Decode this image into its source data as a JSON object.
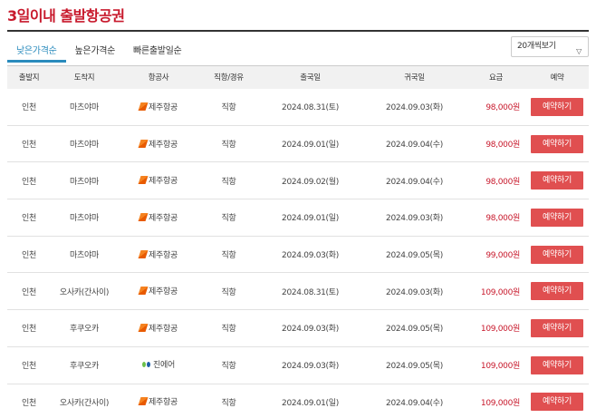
{
  "page": {
    "title": "3일이내 출발항공권"
  },
  "tabs": [
    {
      "label": "낮은가격순",
      "active": true
    },
    {
      "label": "높은가격순",
      "active": false
    },
    {
      "label": "빠른출발일순",
      "active": false
    }
  ],
  "per_page": {
    "selected": "20개씩보기"
  },
  "table": {
    "headers": [
      "출발지",
      "도착지",
      "항공사",
      "직항/경유",
      "출국일",
      "귀국일",
      "요금",
      "예약"
    ],
    "reserve_label": "예약하기",
    "rows": [
      {
        "from": "인천",
        "to": "마츠야마",
        "airline": "제주항공",
        "airline_icon": "jeju-air-logo-icon",
        "type": "직항",
        "depart": "2024.08.31(토)",
        "return": "2024.09.03(화)",
        "price": "98,000원"
      },
      {
        "from": "인천",
        "to": "마츠야마",
        "airline": "제주항공",
        "airline_icon": "jeju-air-logo-icon",
        "type": "직항",
        "depart": "2024.09.01(일)",
        "return": "2024.09.04(수)",
        "price": "98,000원"
      },
      {
        "from": "인천",
        "to": "마츠야마",
        "airline": "제주항공",
        "airline_icon": "jeju-air-logo-icon",
        "type": "직항",
        "depart": "2024.09.02(월)",
        "return": "2024.09.04(수)",
        "price": "98,000원"
      },
      {
        "from": "인천",
        "to": "마츠야마",
        "airline": "제주항공",
        "airline_icon": "jeju-air-logo-icon",
        "type": "직항",
        "depart": "2024.09.01(일)",
        "return": "2024.09.03(화)",
        "price": "98,000원"
      },
      {
        "from": "인천",
        "to": "마츠야마",
        "airline": "제주항공",
        "airline_icon": "jeju-air-logo-icon",
        "type": "직항",
        "depart": "2024.09.03(화)",
        "return": "2024.09.05(목)",
        "price": "99,000원"
      },
      {
        "from": "인천",
        "to": "오사카(간사이)",
        "airline": "제주항공",
        "airline_icon": "jeju-air-logo-icon",
        "type": "직항",
        "depart": "2024.08.31(토)",
        "return": "2024.09.03(화)",
        "price": "109,000원"
      },
      {
        "from": "인천",
        "to": "후쿠오카",
        "airline": "제주항공",
        "airline_icon": "jeju-air-logo-icon",
        "type": "직항",
        "depart": "2024.09.03(화)",
        "return": "2024.09.05(목)",
        "price": "109,000원"
      },
      {
        "from": "인천",
        "to": "후쿠오카",
        "airline": "진에어",
        "airline_icon": "jin-air-logo-icon",
        "type": "직항",
        "depart": "2024.09.03(화)",
        "return": "2024.09.05(목)",
        "price": "109,000원"
      },
      {
        "from": "인천",
        "to": "오사카(간사이)",
        "airline": "제주항공",
        "airline_icon": "jeju-air-logo-icon",
        "type": "직항",
        "depart": "2024.09.01(일)",
        "return": "2024.09.04(수)",
        "price": "109,000원"
      }
    ]
  },
  "colors": {
    "accent": "#c8192c",
    "tab_active": "#2a8bbd",
    "button": "#e04f50",
    "header_bg": "#f1f1f1"
  }
}
